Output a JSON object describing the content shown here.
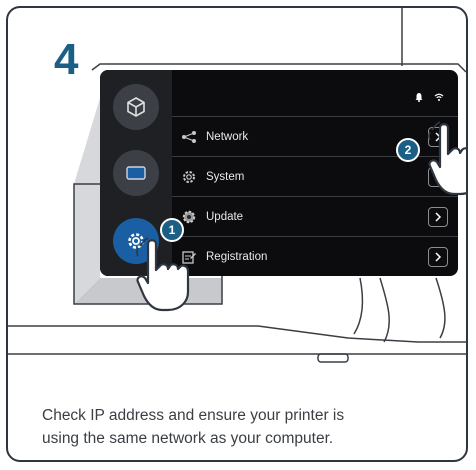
{
  "step": {
    "number": "4"
  },
  "screen": {
    "status_icons": [
      "bell-icon",
      "wifi-icon"
    ],
    "sidebar": [
      {
        "name": "cube-icon",
        "active": false
      },
      {
        "name": "monitor-icon",
        "active": false
      },
      {
        "name": "gear-icon",
        "active": true
      }
    ],
    "menu": [
      {
        "label": "Network",
        "icon": "network-icon"
      },
      {
        "label": "System",
        "icon": "system-gear-icon"
      },
      {
        "label": "Update",
        "icon": "update-gear-icon"
      },
      {
        "label": "Registration",
        "icon": "registration-icon"
      }
    ]
  },
  "callouts": [
    "1",
    "2"
  ],
  "instruction": {
    "line1": "Check IP address and ensure your printer is",
    "line2": "using the same network as your computer."
  },
  "colors": {
    "accent": "#1b5f86",
    "screen_bg": "#0c0c0e",
    "active_button": "#1a5fa3",
    "frame": "#2f3640"
  }
}
